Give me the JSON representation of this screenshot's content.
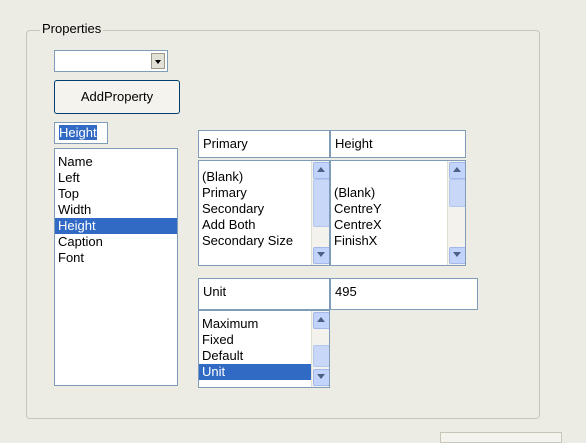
{
  "group": {
    "title": "Properties"
  },
  "combo": {
    "value": ""
  },
  "add_property": {
    "label": "AddProperty"
  },
  "left_list": {
    "field_value": "Height",
    "items": [
      "Name",
      "Left",
      "Top",
      "Width",
      "Height",
      "Caption",
      "Font"
    ],
    "selected": "Height"
  },
  "primary_panel": {
    "field_left": "Primary",
    "field_right": "Height",
    "list_left_items": [
      "(Blank)",
      "Primary",
      "Secondary",
      "Add Both",
      "Secondary Size"
    ],
    "list_right_items": [
      "(Blank)",
      "CentreY",
      "CentreX",
      "FinishX"
    ]
  },
  "unit_panel": {
    "field_left": "Unit",
    "field_right": "495",
    "list_items": [
      "Maximum",
      "Fixed",
      "Default",
      "Unit"
    ],
    "selected": "Unit"
  },
  "colors": {
    "selection": "#316ac5",
    "background": "#ecebe4",
    "border": "#7f9db9"
  }
}
